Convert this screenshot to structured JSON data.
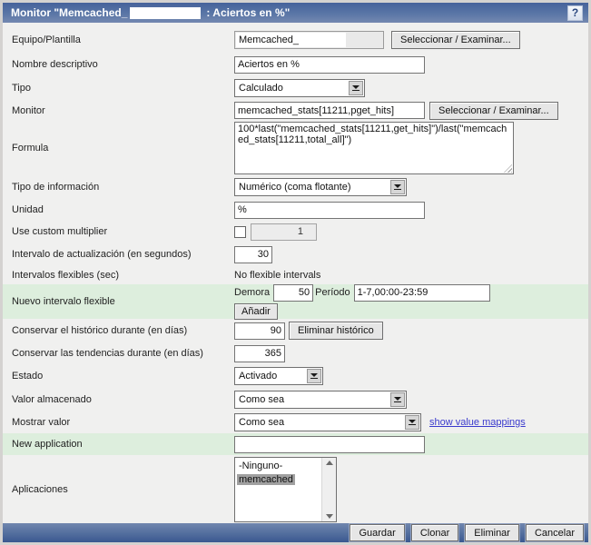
{
  "window": {
    "title_prefix": "Monitor \"Memcached_",
    "title_suffix": ": Aciertos en %\"",
    "help_label": "?"
  },
  "buttons": {
    "select_examine": "Seleccionar / Examinar...",
    "add": "Añadir",
    "delete_history": "Eliminar histórico",
    "save": "Guardar",
    "clone": "Clonar",
    "delete": "Eliminar",
    "cancel": "Cancelar"
  },
  "fields": {
    "host": {
      "label": "Equipo/Plantilla",
      "value": "Memcached_"
    },
    "name": {
      "label": "Nombre descriptivo",
      "value": "Aciertos en %"
    },
    "type": {
      "label": "Tipo",
      "value": "Calculado"
    },
    "key": {
      "label": "Monitor",
      "value": "memcached_stats[11211,pget_hits]"
    },
    "formula": {
      "label": "Formula",
      "value": "100*last(\"memcached_stats[11211,get_hits]\")/last(\"memcached_stats[11211,total_all]\")"
    },
    "info_type": {
      "label": "Tipo de información",
      "value": "Numérico (coma flotante)"
    },
    "units": {
      "label": "Unidad",
      "value": "%"
    },
    "multiplier": {
      "label": "Use custom multiplier",
      "value": "1",
      "checked": false
    },
    "interval": {
      "label": "Intervalo de actualización (en segundos)",
      "value": "30"
    },
    "flexible": {
      "label": "Intervalos flexibles (sec)",
      "value": "No flexible intervals"
    },
    "new_flexible": {
      "label": "Nuevo intervalo flexible",
      "delay_label": "Demora",
      "delay_value": "50",
      "period_label": "Período",
      "period_value": "1-7,00:00-23:59"
    },
    "history": {
      "label": "Conservar el histórico durante (en días)",
      "value": "90"
    },
    "trends": {
      "label": "Conservar las tendencias durante (en días)",
      "value": "365"
    },
    "status": {
      "label": "Estado",
      "value": "Activado"
    },
    "store_value": {
      "label": "Valor almacenado",
      "value": "Como sea"
    },
    "show_value": {
      "label": "Mostrar valor",
      "value": "Como sea",
      "link": "show value mappings"
    },
    "new_application": {
      "label": "New application",
      "value": "",
      "placeholder": ""
    },
    "applications": {
      "label": "Aplicaciones",
      "options": [
        "-Ninguno-",
        "memcached"
      ],
      "selected": "memcached"
    }
  },
  "colors": {
    "title_bar_top": "#45629b",
    "title_bar_bottom": "#7488b0",
    "footer_top": "#7086ae",
    "footer_bottom": "#3a5890",
    "highlight_row": "#ddeedd",
    "link": "#3a3acd",
    "selected_option_bg": "#a0a0a0",
    "background": "#f0f0ef"
  }
}
